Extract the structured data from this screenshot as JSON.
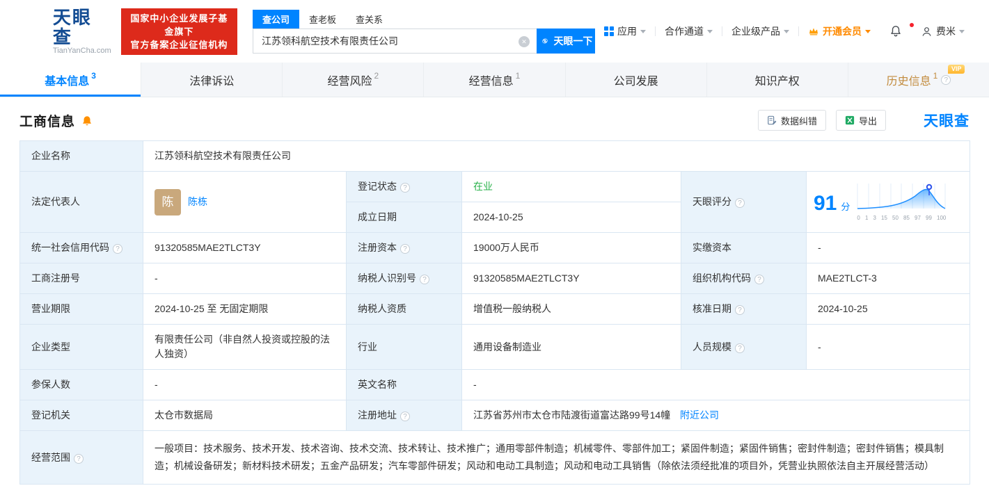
{
  "header": {
    "logo": {
      "brand": "天眼查",
      "domain": "TianYanCha.com"
    },
    "badge": {
      "line1": "国家中小企业发展子基金旗下",
      "line2": "官方备案企业征信机构"
    },
    "search": {
      "tabs": [
        {
          "label": "查公司"
        },
        {
          "label": "查老板"
        },
        {
          "label": "查关系"
        }
      ],
      "input_value": "江苏领科航空技术有限责任公司",
      "button_label": "天眼一下"
    },
    "nav": {
      "apps": "应用",
      "cooperation": "合作通道",
      "enterprise": "企业级产品",
      "vip": "开通会员",
      "user": "费米"
    }
  },
  "tabs": [
    {
      "label": "基本信息",
      "count": "3"
    },
    {
      "label": "法律诉讼",
      "count": ""
    },
    {
      "label": "经营风险",
      "count": "2"
    },
    {
      "label": "经营信息",
      "count": "1"
    },
    {
      "label": "公司发展",
      "count": ""
    },
    {
      "label": "知识产权",
      "count": ""
    },
    {
      "label": "历史信息",
      "count": "1",
      "vip_tag": "VIP"
    }
  ],
  "section": {
    "title": "工商信息",
    "correct_label": "数据纠错",
    "export_label": "导出",
    "watermark": "天眼查"
  },
  "score": {
    "label": "天眼评分",
    "value": "91",
    "unit": "分",
    "axis": [
      "0",
      "1",
      "3",
      "15",
      "50",
      "85",
      "97",
      "99",
      "100"
    ]
  },
  "info": {
    "company_name": {
      "label": "企业名称",
      "value": "江苏领科航空技术有限责任公司"
    },
    "legal_rep": {
      "label": "法定代表人",
      "avatar": "陈",
      "value": "陈栋"
    },
    "reg_status": {
      "label": "登记状态",
      "value": "在业"
    },
    "establish_date": {
      "label": "成立日期",
      "value": "2024-10-25"
    },
    "credit_code": {
      "label": "统一社会信用代码",
      "value": "91320585MAE2TLCT3Y"
    },
    "reg_capital": {
      "label": "注册资本",
      "value": "19000万人民币"
    },
    "paid_capital": {
      "label": "实缴资本",
      "value": "-"
    },
    "reg_number": {
      "label": "工商注册号",
      "value": "-"
    },
    "taxpayer_id": {
      "label": "纳税人识别号",
      "value": "91320585MAE2TLCT3Y"
    },
    "org_code": {
      "label": "组织机构代码",
      "value": "MAE2TLCT-3"
    },
    "business_term": {
      "label": "营业期限",
      "value": "2024-10-25 至 无固定期限"
    },
    "taxpayer_quality": {
      "label": "纳税人资质",
      "value": "增值税一般纳税人"
    },
    "approval_date": {
      "label": "核准日期",
      "value": "2024-10-25"
    },
    "company_type": {
      "label": "企业类型",
      "value": "有限责任公司（非自然人投资或控股的法人独资）"
    },
    "industry": {
      "label": "行业",
      "value": "通用设备制造业"
    },
    "staff_size": {
      "label": "人员规模",
      "value": "-"
    },
    "insured_count": {
      "label": "参保人数",
      "value": "-"
    },
    "english_name": {
      "label": "英文名称",
      "value": "-"
    },
    "reg_authority": {
      "label": "登记机关",
      "value": "太仓市数据局"
    },
    "reg_address": {
      "label": "注册地址",
      "value": "江苏省苏州市太仓市陆渡街道富达路99号14幢",
      "nearby_link": "附近公司"
    },
    "business_scope": {
      "label": "经营范围",
      "value": "一般项目：技术服务、技术开发、技术咨询、技术交流、技术转让、技术推广；通用零部件制造；机械零件、零部件加工；紧固件制造；紧固件销售；密封件制造；密封件销售；模具制造；机械设备研发；新材料技术研发；五金产品研发；汽车零部件研发；风动和电动工具制造；风动和电动工具销售（除依法须经批准的项目外，凭营业执照依法自主开展经营活动）"
    }
  }
}
